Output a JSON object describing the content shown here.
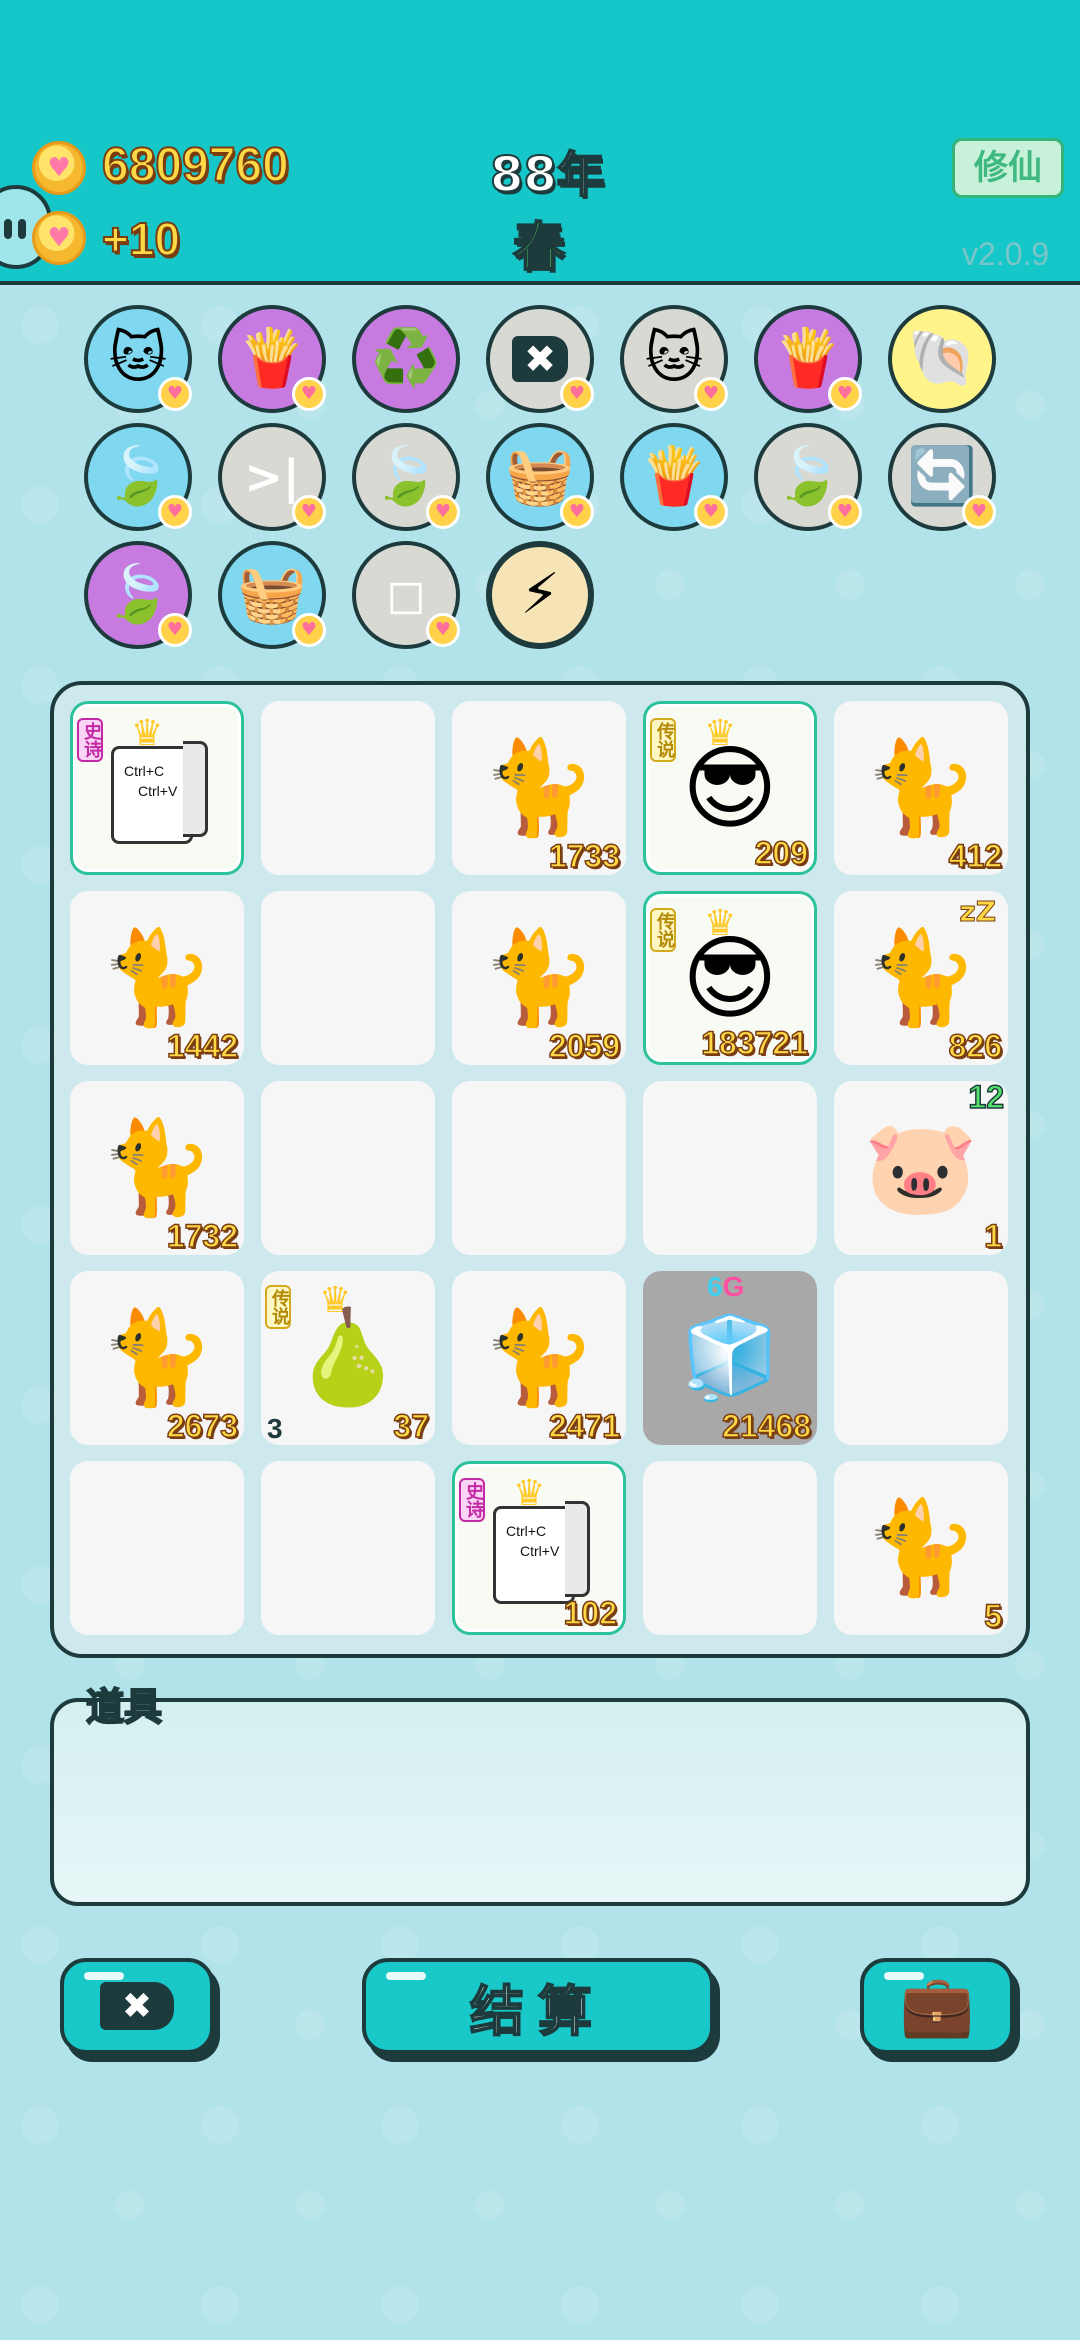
{
  "header": {
    "coins": "6809760",
    "coin_gain": "+10",
    "year": "88年",
    "season": "春",
    "mode_button": "修仙",
    "version": "v2.0.9",
    "colors": {
      "header_bg": "#15c7c9",
      "coin_text": "#ffd945",
      "season_text": "#5fe15d"
    }
  },
  "tools": [
    {
      "icon": "cat-icon",
      "glyph": "🐱",
      "color": "blue",
      "badge": true
    },
    {
      "icon": "fries-icon",
      "glyph": "🍟",
      "color": "purple",
      "badge": true
    },
    {
      "icon": "recycle-icon",
      "glyph": "♻️",
      "color": "purple",
      "badge": false
    },
    {
      "icon": "delete-tag-icon",
      "glyph": "✖",
      "color": "gray",
      "badge": true
    },
    {
      "icon": "cats-pair-icon",
      "glyph": "🐱",
      "color": "gray",
      "badge": true
    },
    {
      "icon": "fries-icon",
      "glyph": "🍟",
      "color": "purple",
      "badge": true
    },
    {
      "icon": "shell-icon",
      "glyph": "🐚",
      "color": "yellow",
      "badge": false
    },
    {
      "icon": "leaf-icon",
      "glyph": "🍃",
      "color": "blue",
      "badge": true
    },
    {
      "icon": "skip-icon",
      "glyph": ">|",
      "color": "gray",
      "badge": true
    },
    {
      "icon": "leaf-icon",
      "glyph": "🍃",
      "color": "gray",
      "badge": true
    },
    {
      "icon": "fruit-basket-icon",
      "glyph": "🧺",
      "color": "blue",
      "badge": true
    },
    {
      "icon": "fries-icon",
      "glyph": "🍟",
      "color": "blue",
      "badge": true
    },
    {
      "icon": "leaf-icon",
      "glyph": "🍃",
      "color": "gray",
      "badge": true
    },
    {
      "icon": "refresh-icon",
      "glyph": "🔄",
      "color": "gray",
      "badge": true
    },
    {
      "icon": "leaf-icon",
      "glyph": "🍃",
      "color": "purple",
      "badge": true
    },
    {
      "icon": "fruit-basket-icon",
      "glyph": "🧺",
      "color": "blue",
      "badge": true
    },
    {
      "icon": "sugar-cubes-icon",
      "glyph": "◻",
      "color": "gray",
      "badge": true
    },
    {
      "icon": "lightning-icon",
      "glyph": "⚡",
      "color": "flash",
      "badge": false
    }
  ],
  "board": {
    "rows": [
      [
        {
          "type": "ctrl-card",
          "tag": "史诗",
          "tag_kind": "shi",
          "text": [
            "Ctrl+C",
            "Ctrl+V"
          ],
          "value": ""
        },
        {
          "type": "empty"
        },
        {
          "type": "cat",
          "value": "1733"
        },
        {
          "type": "face-crown",
          "tag": "传说",
          "tag_kind": "chuan",
          "value": "209"
        },
        {
          "type": "cat",
          "value": "412"
        }
      ],
      [
        {
          "type": "cat",
          "value": "1442"
        },
        {
          "type": "empty"
        },
        {
          "type": "cat",
          "value": "2059"
        },
        {
          "type": "face-crown",
          "tag": "传说",
          "tag_kind": "chuan",
          "value": "183721"
        },
        {
          "type": "cat-sleep",
          "value": "826"
        }
      ],
      [
        {
          "type": "cat",
          "value": "1732"
        },
        {
          "type": "empty"
        },
        {
          "type": "empty"
        },
        {
          "type": "empty"
        },
        {
          "type": "pig",
          "top": "12",
          "value": "1"
        }
      ],
      [
        {
          "type": "cat",
          "value": "2673"
        },
        {
          "type": "pear",
          "tag": "传说",
          "tag_kind": "chuan",
          "level": "3",
          "value": "37"
        },
        {
          "type": "cat",
          "value": "2471"
        },
        {
          "type": "fridge",
          "storage": "6G",
          "value": "21468"
        },
        {
          "type": "empty"
        }
      ],
      [
        {
          "type": "empty"
        },
        {
          "type": "empty"
        },
        {
          "type": "ctrl-card",
          "tag": "史诗",
          "tag_kind": "shi",
          "text": [
            "Ctrl+C",
            "Ctrl+V"
          ],
          "value": "102"
        },
        {
          "type": "empty"
        },
        {
          "type": "cat",
          "value": "5"
        }
      ]
    ]
  },
  "items": {
    "label": "道具"
  },
  "footer": {
    "settle_label": "结算",
    "delete_icon": "✖",
    "bag_icon": "💼"
  }
}
